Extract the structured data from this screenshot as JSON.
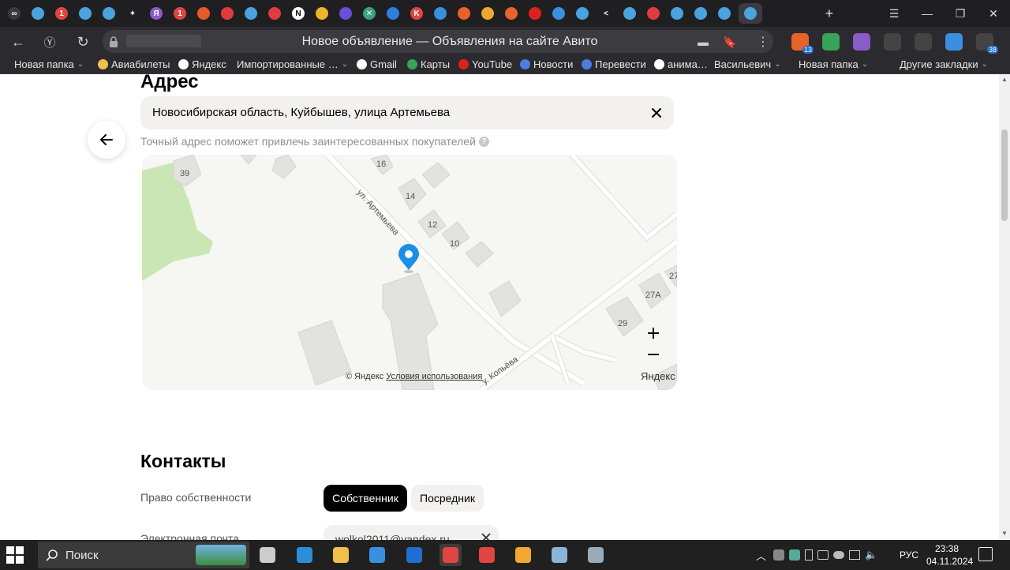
{
  "browser": {
    "page_title": "Новое объявление — Объявления на сайте Авито",
    "tabs": [
      {
        "icon": "infinity-icon",
        "color": "#3a3a40",
        "symbol": "∞"
      },
      {
        "icon": "dots-icon",
        "color": "#4aa3df",
        "symbol": ""
      },
      {
        "icon": "badge-icon",
        "color": "#e0463f",
        "symbol": "1"
      },
      {
        "icon": "dots-icon",
        "color": "#4aa3df",
        "symbol": ""
      },
      {
        "icon": "dots-icon",
        "color": "#4aa3df",
        "symbol": ""
      },
      {
        "icon": "sparkle-icon",
        "color": "#1f1f22",
        "symbol": "✦"
      },
      {
        "icon": "yandex-icon",
        "color": "#8a5cc9",
        "symbol": "Я"
      },
      {
        "icon": "badge-icon",
        "color": "#e0463f",
        "symbol": "1"
      },
      {
        "icon": "ok-icon",
        "color": "#e85a2a",
        "symbol": ""
      },
      {
        "icon": "mail-icon",
        "color": "#e03c3c",
        "symbol": ""
      },
      {
        "icon": "dots-icon",
        "color": "#4aa3df",
        "symbol": ""
      },
      {
        "icon": "mail-icon",
        "color": "#e03c3c",
        "symbol": ""
      },
      {
        "icon": "notion-icon",
        "color": "#ffffff",
        "symbol": "N"
      },
      {
        "icon": "circle-icon",
        "color": "#f0b429",
        "symbol": ""
      },
      {
        "icon": "eye-icon",
        "color": "#6b4fd8",
        "symbol": ""
      },
      {
        "icon": "cross-icon",
        "color": "#3aa37a",
        "symbol": "✕"
      },
      {
        "icon": "vk-icon",
        "color": "#2f7ee0",
        "symbol": ""
      },
      {
        "icon": "k-icon",
        "color": "#e0463f",
        "symbol": "K"
      },
      {
        "icon": "image-icon",
        "color": "#3b8fe0",
        "symbol": ""
      },
      {
        "icon": "orange-icon",
        "color": "#e8632a",
        "symbol": ""
      },
      {
        "icon": "folder-icon",
        "color": "#f0a830",
        "symbol": ""
      },
      {
        "icon": "pin-icon",
        "color": "#e8632a",
        "symbol": ""
      },
      {
        "icon": "youtube-icon",
        "color": "#e02020",
        "symbol": ""
      },
      {
        "icon": "wave-icon",
        "color": "#3b8fe0",
        "symbol": ""
      },
      {
        "icon": "dots-icon",
        "color": "#4aa3df",
        "symbol": ""
      },
      {
        "icon": "chevron-left-icon",
        "color": "#1f1f22",
        "symbol": "<"
      },
      {
        "icon": "dots-icon",
        "color": "#4aa3df",
        "symbol": ""
      },
      {
        "icon": "mail-icon",
        "color": "#e03c3c",
        "symbol": ""
      },
      {
        "icon": "dots-icon",
        "color": "#4aa3df",
        "symbol": ""
      },
      {
        "icon": "dots-icon",
        "color": "#4aa3df",
        "symbol": ""
      },
      {
        "icon": "dots-icon",
        "color": "#4aa3df",
        "symbol": ""
      },
      {
        "icon": "dots-icon",
        "color": "#4aa3df",
        "symbol": "",
        "active": true
      }
    ],
    "bookmarks": [
      {
        "label": "Новая папка",
        "icon": "folder-icon",
        "color": "#f0c04a",
        "dropdown": true
      },
      {
        "label": "Авиабилеты",
        "icon": "plane-icon",
        "color": "#f0c04a",
        "dropdown": false
      },
      {
        "label": "Яндекс",
        "icon": "star-icon",
        "color": "#ffffff",
        "dropdown": false
      },
      {
        "label": "Импортированные …",
        "icon": "folder-icon",
        "color": "#f0c04a",
        "dropdown": true
      },
      {
        "label": "Gmail",
        "icon": "google-icon",
        "color": "#ffffff",
        "dropdown": false
      },
      {
        "label": "Карты",
        "icon": "maps-icon",
        "color": "#3aa35a",
        "dropdown": false
      },
      {
        "label": "YouTube",
        "icon": "youtube-icon",
        "color": "#e02020",
        "dropdown": false
      },
      {
        "label": "Новости",
        "icon": "news-icon",
        "color": "#4a7ee0",
        "dropdown": false
      },
      {
        "label": "Перевести",
        "icon": "translate-icon",
        "color": "#4a7ee0",
        "dropdown": false
      },
      {
        "label": "анима…",
        "icon": "google-icon",
        "color": "#ffffff",
        "dropdown": false
      },
      {
        "label": "Васильевич",
        "icon": "folder-icon",
        "color": "#f0c04a",
        "dropdown": true
      },
      {
        "label": "Новая папка",
        "icon": "folder-icon",
        "color": "#f0c04a",
        "dropdown": true
      },
      {
        "label": "Другие закладки",
        "icon": "folder-icon",
        "color": "#f0c04a",
        "dropdown": true
      }
    ],
    "extensions": [
      {
        "icon": "shield-icon",
        "color": "#e8632a",
        "badge": "13"
      },
      {
        "icon": "drive-icon",
        "color": "#3aa35a",
        "badge": ""
      },
      {
        "icon": "ring-icon",
        "color": "#8a5cc9",
        "badge": ""
      },
      {
        "icon": "play-icon",
        "color": "#444",
        "badge": ""
      },
      {
        "icon": "puzzle-icon",
        "color": "#444",
        "badge": ""
      },
      {
        "icon": "profile-icon",
        "color": "#3b8fe0",
        "badge": ""
      },
      {
        "icon": "download-icon",
        "color": "#444",
        "badge": "38"
      }
    ]
  },
  "page": {
    "section_title": "Адрес",
    "address_value": "Новосибирская область, Куйбышев, улица Артемьева",
    "address_hint": "Точный адрес поможет привлечь заинтересованных покупателей",
    "help_symbol": "?",
    "map": {
      "street_main": "ул. Артемьева",
      "street_side": "у. Копьёва",
      "house_numbers": [
        "39",
        "16",
        "14",
        "12",
        "10",
        "27А",
        "29",
        "27"
      ],
      "attribution": "© Яндекс",
      "terms": "Условия использования",
      "logo": "Яндекс"
    },
    "contacts_title": "Контакты",
    "ownership_label": "Право собственности",
    "ownership_options": [
      "Собственник",
      "Посредник"
    ],
    "email_label": "Электронная почта",
    "email_value": "wolkol2011@yandex.ru"
  },
  "taskbar": {
    "search_placeholder": "Поиск",
    "language": "РУС",
    "time": "23:38",
    "date": "04.11.2024",
    "apps": [
      {
        "icon": "task-view-icon",
        "color": "#ccc"
      },
      {
        "icon": "edge-icon",
        "color": "#2a8fd8"
      },
      {
        "icon": "explorer-icon",
        "color": "#f0c04a"
      },
      {
        "icon": "store-icon",
        "color": "#3b8fe0"
      },
      {
        "icon": "outlook-icon",
        "color": "#1f6fd0"
      },
      {
        "icon": "yandex-browser-icon",
        "color": "#e0463f"
      },
      {
        "icon": "yandex-icon",
        "color": "#e0463f"
      },
      {
        "icon": "mail-app-icon",
        "color": "#f0a830"
      },
      {
        "icon": "notes-icon",
        "color": "#8ab4d8"
      },
      {
        "icon": "window-app-icon",
        "color": "#9ab"
      }
    ]
  }
}
